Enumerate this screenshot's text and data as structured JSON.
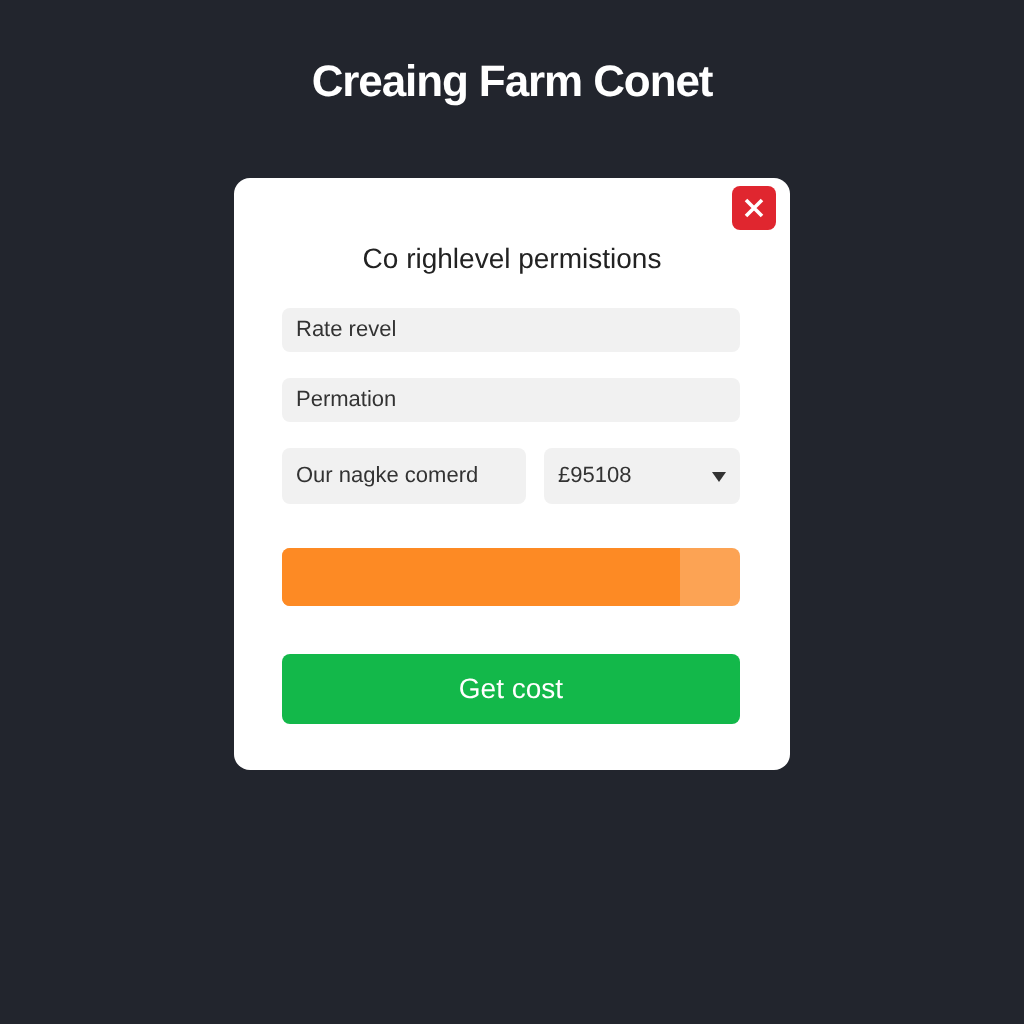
{
  "page_title": "Creaing Farm Conet",
  "dialog": {
    "title": "Co righlevel permistions",
    "fields": [
      {
        "value": "Rate revel"
      },
      {
        "value": "Permation"
      }
    ],
    "row": {
      "text_field": {
        "value": "Our nagke comerd"
      },
      "dropdown": {
        "value": "£95108"
      }
    },
    "progress": {
      "level": 0.87
    },
    "button": "Get cost"
  }
}
